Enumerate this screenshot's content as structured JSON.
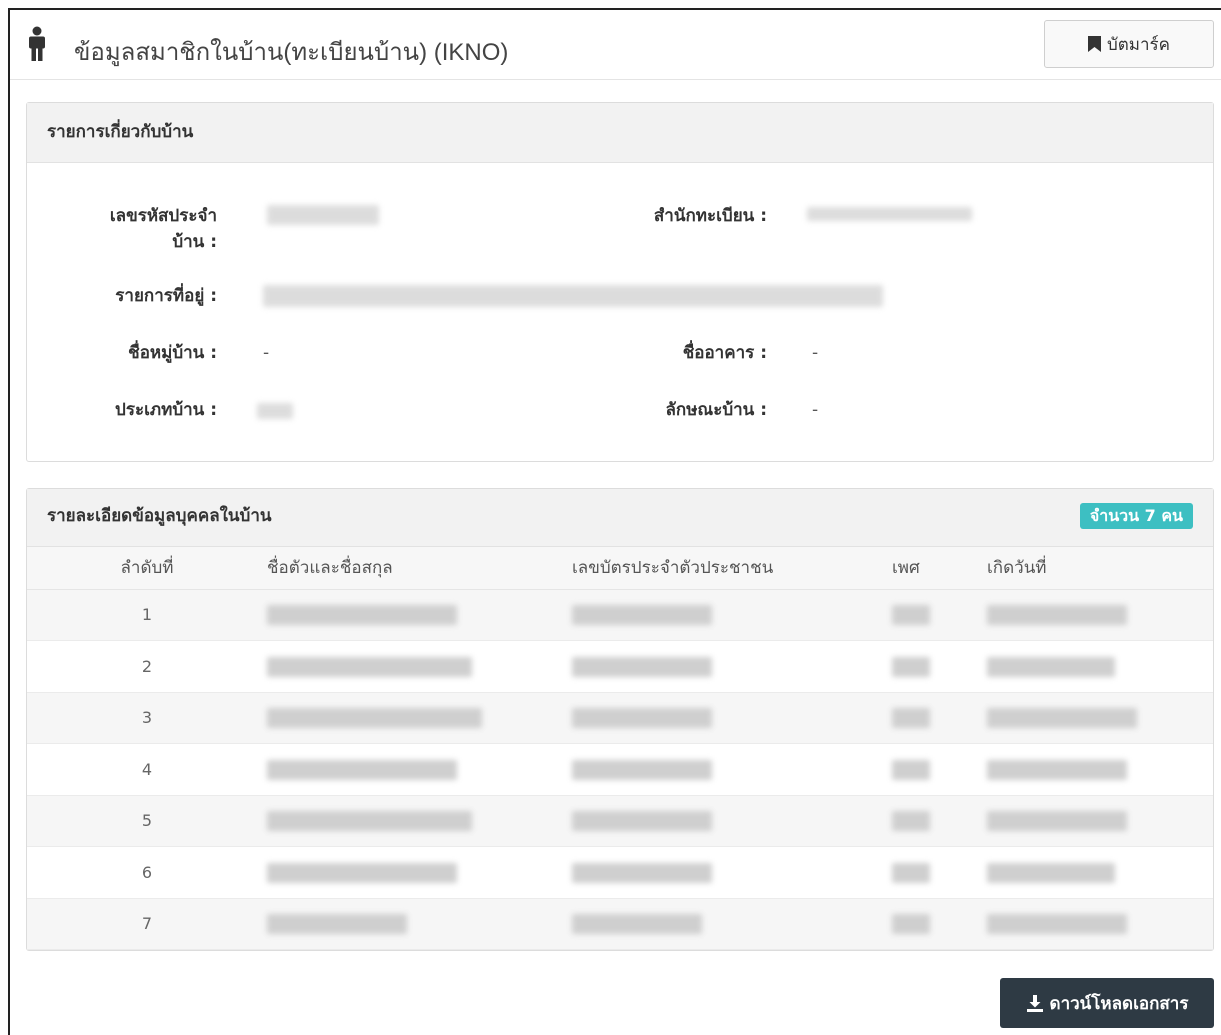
{
  "header": {
    "title": "ข้อมูลสมาชิกในบ้าน(ทะเบียนบ้าน) (IKNO)",
    "bookmark_label": "บัตมาร์ค",
    "icons": {
      "person": "person-icon",
      "bookmark": "bookmark-icon"
    }
  },
  "house_panel": {
    "heading": "รายการเกี่ยวกับบ้าน",
    "labels": {
      "house_code_line1": "เลขรหัสประจำ",
      "house_code_line2": "บ้าน :",
      "registry_office": "สำนักทะเบียน :",
      "address": "รายการที่อยู่ :",
      "village_name": "ชื่อหมู่บ้าน :",
      "building_name": "ชื่ออาคาร :",
      "house_type": "ประเภทบ้าน :",
      "house_style": "ลักษณะบ้าน :"
    },
    "values": {
      "village_name": "-",
      "building_name": "-",
      "house_style": "-"
    }
  },
  "members_panel": {
    "heading": "รายละเอียดข้อมูลบุคคลในบ้าน",
    "count_badge": "จำนวน 7 คน",
    "columns": [
      "ลำดับที่",
      "ชื่อตัวและชื่อสกุล",
      "เลขบัตรประจำตัวประชาชน",
      "เพศ",
      "เกิดวันที่"
    ],
    "rows": [
      {
        "no": "1"
      },
      {
        "no": "2"
      },
      {
        "no": "3"
      },
      {
        "no": "4"
      },
      {
        "no": "5"
      },
      {
        "no": "6"
      },
      {
        "no": "7"
      }
    ]
  },
  "download": {
    "label": "ดาวน์โหลดเอกสาร",
    "icon": "download-icon"
  },
  "colors": {
    "badge": "#3dbfc2",
    "download_button": "#2e3a44",
    "panel_heading": "#f2f2f2"
  }
}
